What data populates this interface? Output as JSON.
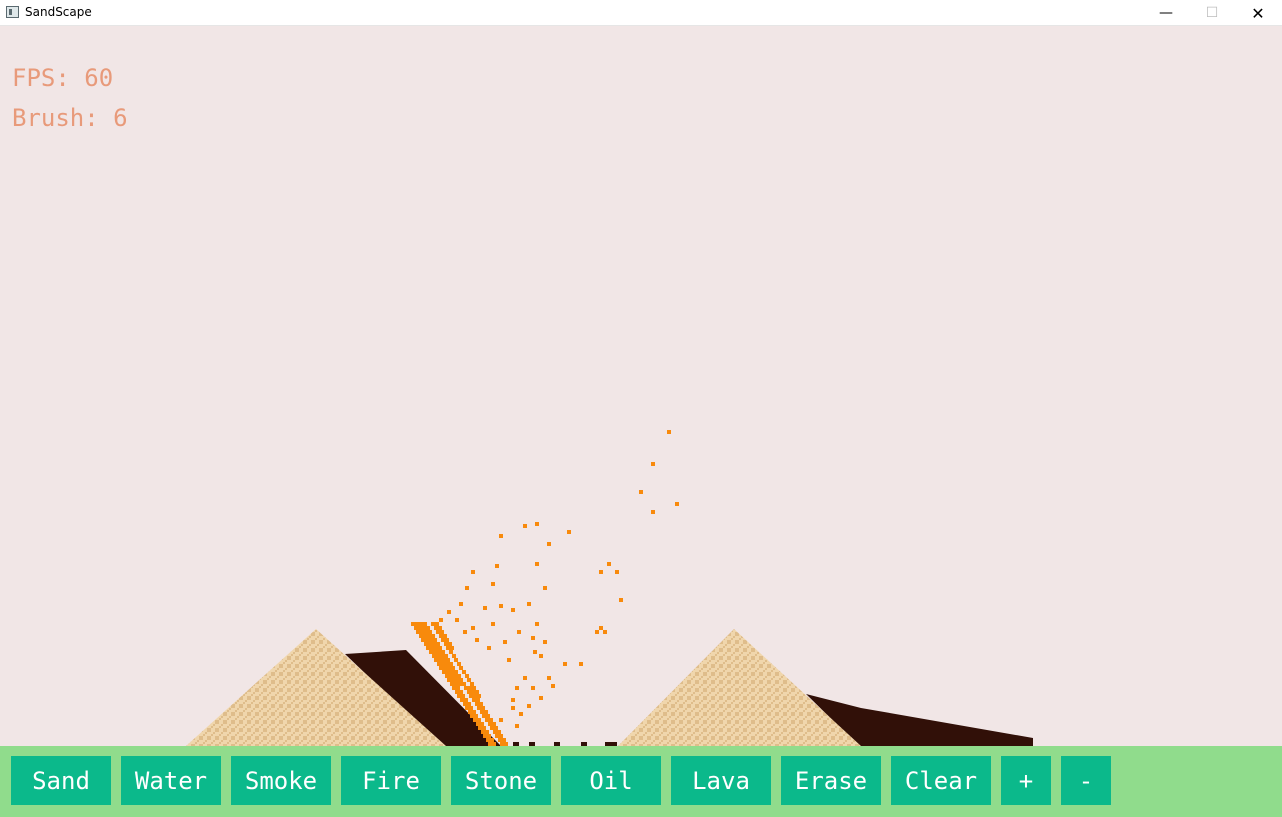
{
  "window": {
    "title": "SandScape",
    "minimize_glyph": "—",
    "maximize_glyph": "☐",
    "close_glyph": "✕",
    "app_icon": "window-app-icon"
  },
  "hud": {
    "fps": "FPS: 60",
    "brush": "Brush: 6"
  },
  "colors": {
    "background": "#f1e6e6",
    "sand_light": "#f0d6ac",
    "sand_dark": "#dfbd8b",
    "stone": "#311008",
    "lava": "#f88a0c",
    "hud_text": "#e89a7a",
    "toolbar_bg": "#90dc8c",
    "button_bg": "#0bb98b",
    "button_text": "#ffffff"
  },
  "toolbar": {
    "buttons": [
      {
        "label": "Sand"
      },
      {
        "label": "Water"
      },
      {
        "label": "Smoke"
      },
      {
        "label": "Fire"
      },
      {
        "label": "Stone"
      },
      {
        "label": "Oil"
      },
      {
        "label": "Lava"
      },
      {
        "label": "Erase"
      },
      {
        "label": "Clear"
      },
      {
        "label": "+"
      },
      {
        "label": "-"
      }
    ]
  }
}
